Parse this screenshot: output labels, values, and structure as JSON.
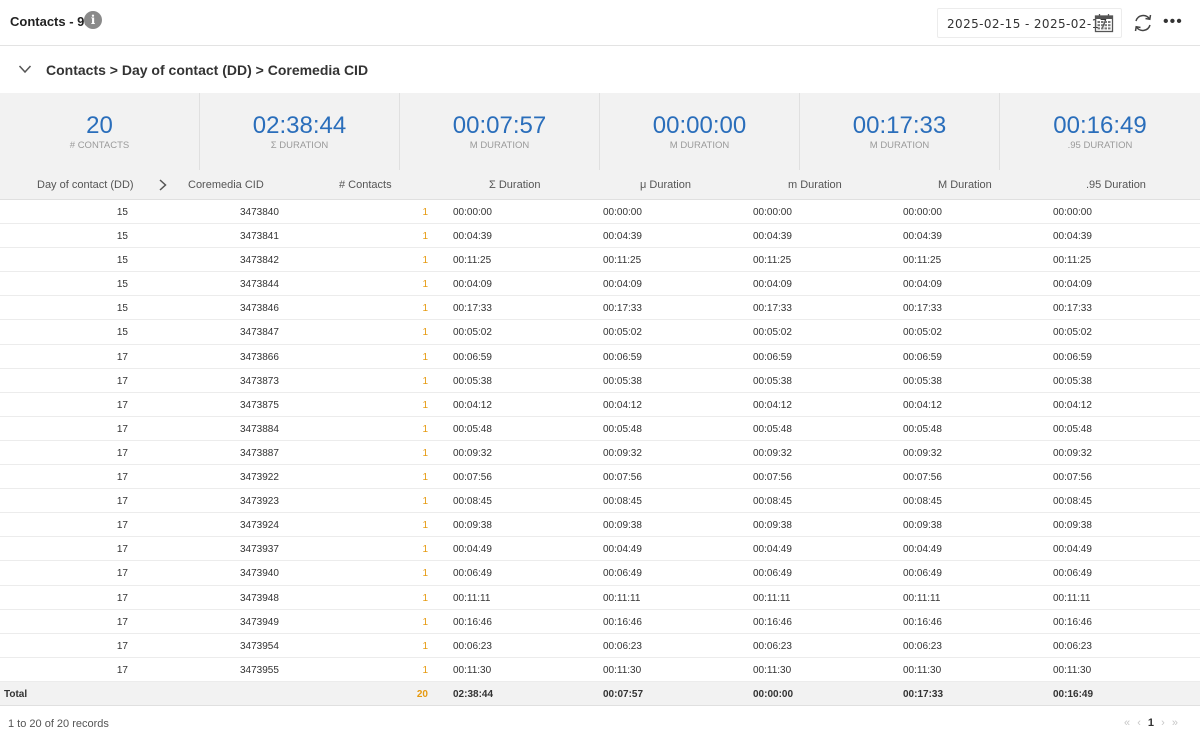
{
  "header": {
    "title": "Contacts - 95",
    "info_icon": "i",
    "date_range": "2025-02-15 - 2025-02-17",
    "more_icon": "•••"
  },
  "breadcrumb": "Contacts > Day of contact (DD) > Coremedia CID",
  "kpis": [
    {
      "value": "20",
      "label": "# CONTACTS"
    },
    {
      "value": "02:38:44",
      "label": "Σ DURATION"
    },
    {
      "value": "00:07:57",
      "label": "μ DURATION"
    },
    {
      "value": "00:00:00",
      "label": "m DURATION"
    },
    {
      "value": "00:17:33",
      "label": "M DURATION"
    },
    {
      "value": "00:16:49",
      "label": ".95 DURATION"
    }
  ],
  "columns": {
    "day": "Day of contact (DD)",
    "cid": "Coremedia CID",
    "count": "# Contacts",
    "sum": "Σ Duration",
    "mu": "μ Duration",
    "m": "m Duration",
    "M": "M Duration",
    "p95": ".95 Duration"
  },
  "rows": [
    {
      "day": "15",
      "cid": "3473840",
      "count": "1",
      "sum": "00:00:00",
      "mu": "00:00:00",
      "m": "00:00:00",
      "M": "00:00:00",
      "p95": "00:00:00"
    },
    {
      "day": "15",
      "cid": "3473841",
      "count": "1",
      "sum": "00:04:39",
      "mu": "00:04:39",
      "m": "00:04:39",
      "M": "00:04:39",
      "p95": "00:04:39"
    },
    {
      "day": "15",
      "cid": "3473842",
      "count": "1",
      "sum": "00:11:25",
      "mu": "00:11:25",
      "m": "00:11:25",
      "M": "00:11:25",
      "p95": "00:11:25"
    },
    {
      "day": "15",
      "cid": "3473844",
      "count": "1",
      "sum": "00:04:09",
      "mu": "00:04:09",
      "m": "00:04:09",
      "M": "00:04:09",
      "p95": "00:04:09"
    },
    {
      "day": "15",
      "cid": "3473846",
      "count": "1",
      "sum": "00:17:33",
      "mu": "00:17:33",
      "m": "00:17:33",
      "M": "00:17:33",
      "p95": "00:17:33"
    },
    {
      "day": "15",
      "cid": "3473847",
      "count": "1",
      "sum": "00:05:02",
      "mu": "00:05:02",
      "m": "00:05:02",
      "M": "00:05:02",
      "p95": "00:05:02"
    },
    {
      "day": "17",
      "cid": "3473866",
      "count": "1",
      "sum": "00:06:59",
      "mu": "00:06:59",
      "m": "00:06:59",
      "M": "00:06:59",
      "p95": "00:06:59"
    },
    {
      "day": "17",
      "cid": "3473873",
      "count": "1",
      "sum": "00:05:38",
      "mu": "00:05:38",
      "m": "00:05:38",
      "M": "00:05:38",
      "p95": "00:05:38"
    },
    {
      "day": "17",
      "cid": "3473875",
      "count": "1",
      "sum": "00:04:12",
      "mu": "00:04:12",
      "m": "00:04:12",
      "M": "00:04:12",
      "p95": "00:04:12"
    },
    {
      "day": "17",
      "cid": "3473884",
      "count": "1",
      "sum": "00:05:48",
      "mu": "00:05:48",
      "m": "00:05:48",
      "M": "00:05:48",
      "p95": "00:05:48"
    },
    {
      "day": "17",
      "cid": "3473887",
      "count": "1",
      "sum": "00:09:32",
      "mu": "00:09:32",
      "m": "00:09:32",
      "M": "00:09:32",
      "p95": "00:09:32"
    },
    {
      "day": "17",
      "cid": "3473922",
      "count": "1",
      "sum": "00:07:56",
      "mu": "00:07:56",
      "m": "00:07:56",
      "M": "00:07:56",
      "p95": "00:07:56"
    },
    {
      "day": "17",
      "cid": "3473923",
      "count": "1",
      "sum": "00:08:45",
      "mu": "00:08:45",
      "m": "00:08:45",
      "M": "00:08:45",
      "p95": "00:08:45"
    },
    {
      "day": "17",
      "cid": "3473924",
      "count": "1",
      "sum": "00:09:38",
      "mu": "00:09:38",
      "m": "00:09:38",
      "M": "00:09:38",
      "p95": "00:09:38"
    },
    {
      "day": "17",
      "cid": "3473937",
      "count": "1",
      "sum": "00:04:49",
      "mu": "00:04:49",
      "m": "00:04:49",
      "M": "00:04:49",
      "p95": "00:04:49"
    },
    {
      "day": "17",
      "cid": "3473940",
      "count": "1",
      "sum": "00:06:49",
      "mu": "00:06:49",
      "m": "00:06:49",
      "M": "00:06:49",
      "p95": "00:06:49"
    },
    {
      "day": "17",
      "cid": "3473948",
      "count": "1",
      "sum": "00:11:11",
      "mu": "00:11:11",
      "m": "00:11:11",
      "M": "00:11:11",
      "p95": "00:11:11"
    },
    {
      "day": "17",
      "cid": "3473949",
      "count": "1",
      "sum": "00:16:46",
      "mu": "00:16:46",
      "m": "00:16:46",
      "M": "00:16:46",
      "p95": "00:16:46"
    },
    {
      "day": "17",
      "cid": "3473954",
      "count": "1",
      "sum": "00:06:23",
      "mu": "00:06:23",
      "m": "00:06:23",
      "M": "00:06:23",
      "p95": "00:06:23"
    },
    {
      "day": "17",
      "cid": "3473955",
      "count": "1",
      "sum": "00:11:30",
      "mu": "00:11:30",
      "m": "00:11:30",
      "M": "00:11:30",
      "p95": "00:11:30"
    }
  ],
  "total": {
    "label": "Total",
    "count": "20",
    "sum": "02:38:44",
    "mu": "00:07:57",
    "m": "00:00:00",
    "M": "00:17:33",
    "p95": "00:16:49"
  },
  "footer": {
    "records": "1 to 20 of 20 records",
    "first": "«",
    "prev": "‹",
    "page": "1",
    "next": "›",
    "last": "»"
  },
  "colors": {
    "accent": "#2a6ebb",
    "count": "#e69a10"
  },
  "icons": [
    "info-icon",
    "calendar-icon",
    "refresh-icon",
    "more-icon",
    "chevron-down-icon",
    "chevron-right-icon"
  ]
}
